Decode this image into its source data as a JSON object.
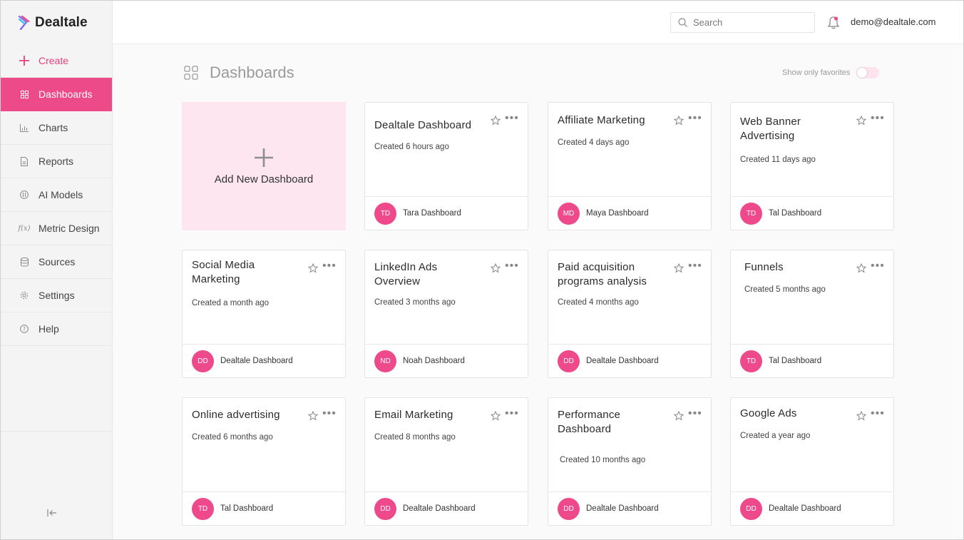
{
  "app": {
    "name": "Dealtale",
    "colors": {
      "accent": "#ed4a8a",
      "accent_light": "#fde6ef"
    }
  },
  "sidebar": {
    "items": [
      {
        "label": "Create",
        "icon": "plus-icon"
      },
      {
        "label": "Dashboards",
        "icon": "grid-icon"
      },
      {
        "label": "Charts",
        "icon": "bar-chart-icon"
      },
      {
        "label": "Reports",
        "icon": "document-icon"
      },
      {
        "label": "AI Models",
        "icon": "ai-icon"
      },
      {
        "label": "Metric Design",
        "icon": "function-icon"
      },
      {
        "label": "Sources",
        "icon": "database-icon"
      },
      {
        "label": "Settings",
        "icon": "gear-icon"
      },
      {
        "label": "Help",
        "icon": "help-icon"
      }
    ],
    "collapse_icon": "collapse-icon"
  },
  "topbar": {
    "search_placeholder": "Search",
    "user_email": "demo@dealtale.com"
  },
  "page": {
    "title": "Dashboards",
    "favorites_label": "Show only favorites",
    "favorites_on": false,
    "add_label": "Add New Dashboard"
  },
  "dashboards": [
    {
      "title": "Dealtale Dashboard",
      "created": "Created 6 hours ago",
      "initials": "TD",
      "owner": "Tara Dashboard"
    },
    {
      "title": "Affiliate Marketing",
      "created": "Created 4 days ago",
      "initials": "MD",
      "owner": "Maya Dashboard"
    },
    {
      "title": "Web Banner Advertising",
      "created": "Created 11 days ago",
      "initials": "TD",
      "owner": "Tal Dashboard"
    },
    {
      "title": "Social Media Marketing",
      "created": "Created a month ago",
      "initials": "DD",
      "owner": "Dealtale Dashboard"
    },
    {
      "title": "LinkedIn Ads Overview",
      "created": "Created 3 months ago",
      "initials": "ND",
      "owner": "Noah Dashboard"
    },
    {
      "title": "Paid acquisition programs analysis",
      "created": "Created 4 months ago",
      "initials": "DD",
      "owner": "Dealtale Dashboard"
    },
    {
      "title": "Funnels",
      "created": "Created 5 months ago",
      "initials": "TD",
      "owner": "Tal Dashboard"
    },
    {
      "title": "Online advertising",
      "created": "Created 6 months ago",
      "initials": "TD",
      "owner": "Tal Dashboard"
    },
    {
      "title": "Email Marketing",
      "created": "Created 8 months ago",
      "initials": "DD",
      "owner": "Dealtale Dashboard"
    },
    {
      "title": "Performance Dashboard",
      "created": "Created 10 months ago",
      "initials": "DD",
      "owner": "Dealtale Dashboard"
    },
    {
      "title": "Google Ads",
      "created": "Created a year ago",
      "initials": "DD",
      "owner": "Dealtale Dashboard"
    }
  ]
}
